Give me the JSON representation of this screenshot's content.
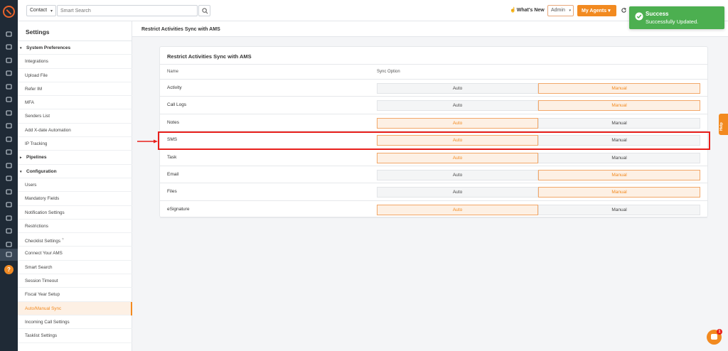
{
  "rail": {
    "icons": [
      "home-icon",
      "users-icon",
      "copy-icon",
      "bank-icon",
      "list-icon",
      "id-card-icon",
      "filter-icon",
      "megaphone-icon",
      "file-icon",
      "chart-bars-icon",
      "folder-icon",
      "google-icon",
      "document-icon",
      "calendar-icon",
      "mail-icon",
      "plane-icon",
      "line-chart-icon",
      "gear-icon",
      "help-icon"
    ],
    "help_glyph": "?"
  },
  "topbar": {
    "context_select": "Contact",
    "search_placeholder": "Smart Search",
    "whats_new": "What's New",
    "admin_select": "Admin",
    "agents_button": "My Agents"
  },
  "toast": {
    "title": "Success",
    "message": "Successfully Updated."
  },
  "settings": {
    "title": "Settings",
    "nav": [
      {
        "type": "group",
        "label": "System Preferences",
        "arrow": "▾"
      },
      {
        "type": "item",
        "label": "Integrations"
      },
      {
        "type": "item",
        "label": "Upload File"
      },
      {
        "type": "item",
        "label": "Refer IM"
      },
      {
        "type": "item",
        "label": "MFA"
      },
      {
        "type": "item",
        "label": "Senders List"
      },
      {
        "type": "item",
        "label": "Add X-date Automation"
      },
      {
        "type": "item",
        "label": "IP Tracking"
      },
      {
        "type": "group",
        "label": "Pipelines",
        "arrow": "▸"
      },
      {
        "type": "group",
        "label": "Configuration",
        "arrow": "▾"
      },
      {
        "type": "item",
        "label": "Users"
      },
      {
        "type": "item",
        "label": "Mandatory Fields"
      },
      {
        "type": "item",
        "label": "Notification Settings"
      },
      {
        "type": "item",
        "label": "Restrictions"
      },
      {
        "type": "item",
        "label": "Checklist Settings",
        "sup": "?"
      },
      {
        "type": "item",
        "label": "Connect Your AMS"
      },
      {
        "type": "item",
        "label": "Smart Search"
      },
      {
        "type": "item",
        "label": "Session Timeout"
      },
      {
        "type": "item",
        "label": "Fiscal Year Setup"
      },
      {
        "type": "item",
        "label": "Auto/Manual Sync",
        "active": true
      },
      {
        "type": "item",
        "label": "Incoming Call Settings"
      },
      {
        "type": "item",
        "label": "Tasklist Settings"
      }
    ]
  },
  "main": {
    "header_title": "Restrict Activities Sync with AMS",
    "card_title": "Restrict Activities Sync with AMS",
    "col_name": "Name",
    "col_sync": "Sync Option",
    "auto_label": "Auto",
    "manual_label": "Manual",
    "rows": [
      {
        "name": "Activity",
        "selected": "manual"
      },
      {
        "name": "Call Logs",
        "selected": "manual"
      },
      {
        "name": "Notes",
        "selected": "auto"
      },
      {
        "name": "SMS",
        "selected": "auto"
      },
      {
        "name": "Task",
        "selected": "auto"
      },
      {
        "name": "Email",
        "selected": "manual"
      },
      {
        "name": "Files",
        "selected": "manual"
      },
      {
        "name": "eSignature",
        "selected": "auto"
      }
    ]
  },
  "help_tab": "Help",
  "chat_badge": "1",
  "colors": {
    "accent": "#f28a20",
    "rail_bg": "#1f2a36",
    "success": "#4caf50",
    "highlight": "#e8201c"
  }
}
